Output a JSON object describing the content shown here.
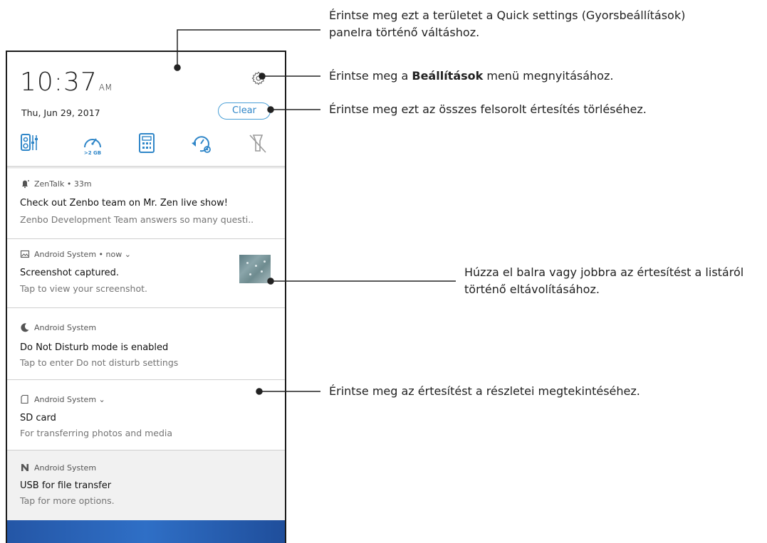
{
  "status": {
    "time": "10:37",
    "ampm": "AM",
    "date": "Thu, Jun 29, 2017",
    "clear_label": "Clear",
    "boost_label": ">2 GB"
  },
  "quick_icons": [
    "audio-wizard-icon",
    "boost-icon",
    "calculator-icon",
    "power-saver-icon",
    "flashlight-off-icon"
  ],
  "notifications": [
    {
      "app": "ZenTalk",
      "meta": " • 33m",
      "title": "Check out Zenbo team on Mr. Zen live show!",
      "text": "Zenbo Development Team answers so many questi..",
      "icon": "bell-icon"
    },
    {
      "app": "Android System",
      "meta": " • now ⌄",
      "title": "Screenshot captured.",
      "text": "Tap to view your screenshot.",
      "icon": "image-icon"
    },
    {
      "app": "Android System",
      "meta": "",
      "title": "Do Not Disturb mode is enabled",
      "text": "Tap to enter Do not disturb settings",
      "icon": "moon-icon"
    },
    {
      "app": "Android System",
      "meta": " ⌄",
      "title": "SD card",
      "text": "For transferring photos and media",
      "icon": "sd-card-icon"
    },
    {
      "app": "Android System",
      "meta": "",
      "title": "USB for file transfer",
      "text": "Tap for more options.",
      "icon": "usb-n-icon"
    }
  ],
  "callouts": {
    "quick_settings": [
      "Érintse meg ezt a területet a Quick settings (Gyorsbeállítások)",
      "panelra történő váltáshoz."
    ],
    "settings_pre": "Érintse meg a ",
    "settings_bold": "Beállítások",
    "settings_post": " menü megnyitásához.",
    "clear": "Érintse meg ezt az összes felsorolt értesítés törléséhez.",
    "swipe": [
      "Húzza el balra vagy jobbra az értesítést a listáról",
      "történő eltávolításához."
    ],
    "details": "Érintse meg az értesítést a részletei megtekintéséhez."
  },
  "colors": {
    "accent": "#2f86c8",
    "wallpaper": "#2456a6"
  }
}
